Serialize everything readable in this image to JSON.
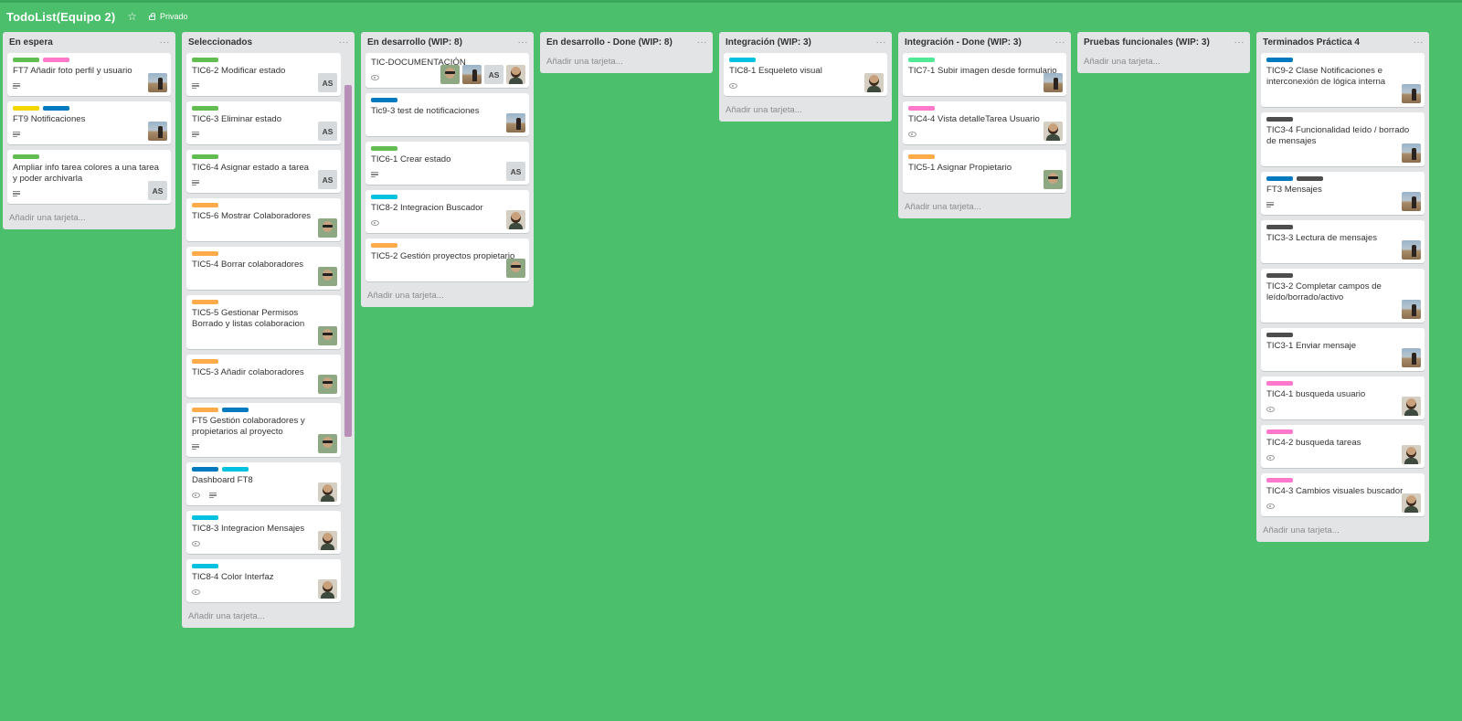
{
  "board": {
    "title": "TodoList(Equipo 2)",
    "privacy": "Privado"
  },
  "add_card_label": "Añadir una tarjeta...",
  "colors": {
    "green": "#61bd4f",
    "pink": "#ff78cb",
    "yellow": "#f2d600",
    "blue": "#0079bf",
    "orange": "#ffab4a",
    "sky": "#00c2e0",
    "dark": "#4d4d4d",
    "lime": "#51e898",
    "background": "#4bbf6b",
    "list": "#e2e4e6"
  },
  "lists": [
    {
      "title": "En espera",
      "cards": [
        {
          "title": "FT7 Añadir foto perfil y usuario",
          "labels": [
            "green",
            "pink"
          ],
          "badges": [
            "desc"
          ],
          "members": [
            "desert"
          ]
        },
        {
          "title": "FT9 Notificaciones",
          "labels": [
            "yellow",
            "blue"
          ],
          "badges": [
            "desc"
          ],
          "members": [
            "desert"
          ]
        },
        {
          "title": "Ampliar info tarea colores a una tarea y poder archivarla",
          "labels": [
            "green"
          ],
          "badges": [
            "desc"
          ],
          "members": [
            "AS"
          ]
        }
      ]
    },
    {
      "title": "Seleccionados",
      "cards": [
        {
          "title": "TIC6-2 Modificar estado",
          "labels": [
            "green"
          ],
          "badges": [
            "desc"
          ],
          "members": [
            "AS"
          ]
        },
        {
          "title": "TIC6-3 Eliminar estado",
          "labels": [
            "green"
          ],
          "badges": [
            "desc"
          ],
          "members": [
            "AS"
          ]
        },
        {
          "title": "TIC6-4 Asignar estado a tarea",
          "labels": [
            "green"
          ],
          "badges": [
            "desc"
          ],
          "members": [
            "AS"
          ]
        },
        {
          "title": "TIC5-6 Mostrar Colaboradores",
          "labels": [
            "orange"
          ],
          "badges": [],
          "members": [
            "glasses"
          ]
        },
        {
          "title": "TIC5-4 Borrar colaboradores",
          "labels": [
            "orange"
          ],
          "badges": [],
          "members": [
            "glasses"
          ]
        },
        {
          "title": "TIC5-5 Gestionar Permisos Borrado y listas colaboracion",
          "labels": [
            "orange"
          ],
          "badges": [],
          "members": [
            "glasses"
          ]
        },
        {
          "title": "TIC5-3 Añadir colaboradores",
          "labels": [
            "orange"
          ],
          "badges": [],
          "members": [
            "glasses"
          ]
        },
        {
          "title": "FT5 Gestión colaboradores y propietarios al proyecto",
          "labels": [
            "orange",
            "blue"
          ],
          "badges": [
            "desc"
          ],
          "members": [
            "glasses"
          ]
        },
        {
          "title": "Dashboard FT8",
          "labels": [
            "blue",
            "sky"
          ],
          "badges": [
            "eye",
            "desc"
          ],
          "members": [
            "man"
          ]
        },
        {
          "title": "TIC8-3 Integracion Mensajes",
          "labels": [
            "sky"
          ],
          "badges": [
            "eye"
          ],
          "members": [
            "man"
          ]
        },
        {
          "title": "TIC8-4 Color Interfaz",
          "labels": [
            "sky"
          ],
          "badges": [
            "eye"
          ],
          "members": [
            "man"
          ]
        }
      ]
    },
    {
      "title": "En desarrollo (WIP: 8)",
      "cards": [
        {
          "title": "TIC-DOCUMENTACIÓN",
          "labels": [],
          "badges": [
            "eye"
          ],
          "members": [
            "glasses",
            "desert",
            "AS",
            "man"
          ]
        },
        {
          "title": "Tic9-3 test de notificaciones",
          "labels": [
            "blue"
          ],
          "badges": [],
          "members": [
            "desert"
          ]
        },
        {
          "title": "TIC6-1 Crear estado",
          "labels": [
            "green"
          ],
          "badges": [
            "desc"
          ],
          "members": [
            "AS"
          ]
        },
        {
          "title": "TIC8-2 Integracion Buscador",
          "labels": [
            "sky"
          ],
          "badges": [
            "eye"
          ],
          "members": [
            "man"
          ]
        },
        {
          "title": "TIC5-2 Gestión proyectos propietario",
          "labels": [
            "orange"
          ],
          "badges": [],
          "members": [
            "glasses"
          ]
        }
      ]
    },
    {
      "title": "En desarrollo - Done (WIP: 8)",
      "cards": []
    },
    {
      "title": "Integración (WIP: 3)",
      "cards": [
        {
          "title": "TIC8-1 Esqueleto visual",
          "labels": [
            "sky"
          ],
          "badges": [
            "eye"
          ],
          "members": [
            "man"
          ]
        }
      ]
    },
    {
      "title": "Integración - Done (WIP: 3)",
      "cards": [
        {
          "title": "TIC7-1 Subir imagen desde formulario",
          "labels": [
            "lime"
          ],
          "badges": [],
          "members": [
            "desert"
          ]
        },
        {
          "title": "TIC4-4 Vista detalleTarea Usuario",
          "labels": [
            "pink"
          ],
          "badges": [
            "eye"
          ],
          "members": [
            "man"
          ]
        },
        {
          "title": "TIC5-1 Asignar Propietario",
          "labels": [
            "orange"
          ],
          "badges": [],
          "members": [
            "glasses"
          ]
        }
      ]
    },
    {
      "title": "Pruebas funcionales (WIP: 3)",
      "cards": []
    },
    {
      "title": "Terminados Práctica 4",
      "cards": [
        {
          "title": "TIC9-2 Clase Notificaciones e interconexión de lógica interna",
          "labels": [
            "blue"
          ],
          "badges": [],
          "members": [
            "desert"
          ]
        },
        {
          "title": "TIC3-4 Funcionalidad leído / borrado de mensajes",
          "labels": [
            "dark"
          ],
          "badges": [],
          "members": [
            "desert"
          ]
        },
        {
          "title": "FT3 Mensajes",
          "labels": [
            "blue",
            "dark"
          ],
          "badges": [
            "desc"
          ],
          "members": [
            "desert"
          ]
        },
        {
          "title": "TIC3-3 Lectura de mensajes",
          "labels": [
            "dark"
          ],
          "badges": [],
          "members": [
            "desert"
          ]
        },
        {
          "title": "TIC3-2 Completar campos de leído/borrado/activo",
          "labels": [
            "dark"
          ],
          "badges": [],
          "members": [
            "desert"
          ]
        },
        {
          "title": "TIC3-1 Enviar mensaje",
          "labels": [
            "dark"
          ],
          "badges": [],
          "members": [
            "desert"
          ]
        },
        {
          "title": "TIC4-1 busqueda usuario",
          "labels": [
            "pink"
          ],
          "badges": [
            "eye"
          ],
          "members": [
            "man"
          ]
        },
        {
          "title": "TIC4-2 busqueda tareas",
          "labels": [
            "pink"
          ],
          "badges": [
            "eye"
          ],
          "members": [
            "man"
          ]
        },
        {
          "title": "TIC4-3 Cambios visuales buscador",
          "labels": [
            "pink"
          ],
          "badges": [
            "eye"
          ],
          "members": [
            "man"
          ]
        }
      ]
    }
  ]
}
